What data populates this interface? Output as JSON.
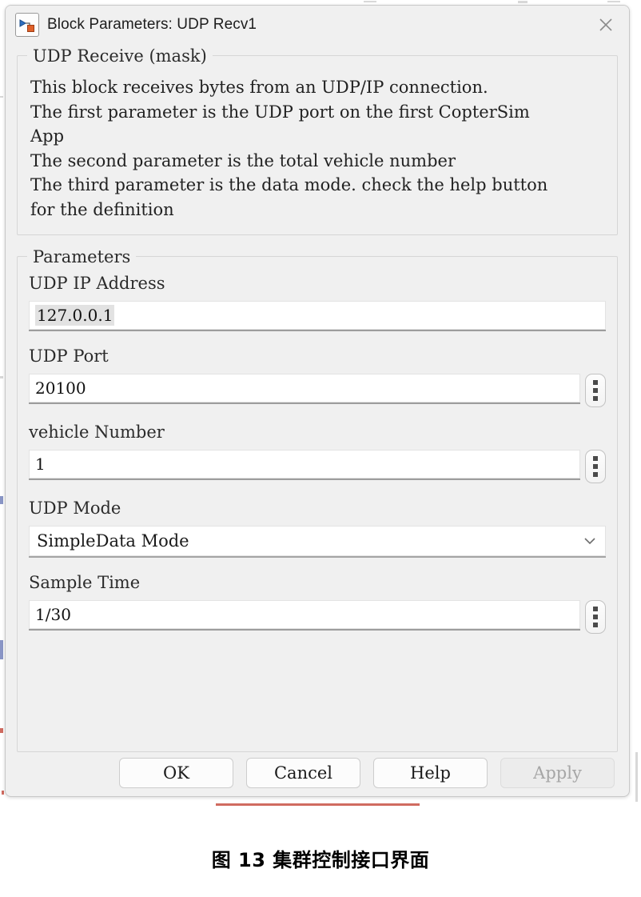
{
  "window": {
    "title": "Block Parameters: UDP Recv1",
    "icon": "simulink-block-icon",
    "close_icon": "close-icon"
  },
  "description_group": {
    "legend": "UDP Receive (mask)",
    "lines": [
      "This block receives bytes from an UDP/IP connection.",
      "The first parameter is the UDP port on the first CopterSim",
      "App",
      "The second parameter is the total vehicle number",
      "The third parameter is the data mode. check the help button",
      "for the definition"
    ]
  },
  "parameters_group": {
    "legend": "Parameters",
    "fields": [
      {
        "label": "UDP IP Address",
        "value": "127.0.0.1",
        "type": "text",
        "selected": true,
        "has_spinner": false
      },
      {
        "label": "UDP Port",
        "value": "20100",
        "type": "text",
        "selected": false,
        "has_spinner": true
      },
      {
        "label": "vehicle Number",
        "value": "1",
        "type": "text",
        "selected": false,
        "has_spinner": true
      },
      {
        "label": "UDP Mode",
        "value": "SimpleData Mode",
        "type": "select",
        "selected": false,
        "has_spinner": false
      },
      {
        "label": "Sample Time",
        "value": "1/30",
        "type": "text",
        "selected": false,
        "has_spinner": true
      }
    ]
  },
  "footer": {
    "buttons": [
      {
        "label": "OK",
        "enabled": true
      },
      {
        "label": "Cancel",
        "enabled": true
      },
      {
        "label": "Help",
        "enabled": true
      },
      {
        "label": "Apply",
        "enabled": false
      }
    ]
  },
  "caption": "图 13 集群控制接口界面",
  "colors": {
    "dialog_bg": "#f0f0f0",
    "input_bg": "#ffffff",
    "text": "#222222",
    "disabled_text": "#a6a6a6",
    "icon_blue": "#2f6fc0",
    "icon_orange": "#e0612a"
  }
}
